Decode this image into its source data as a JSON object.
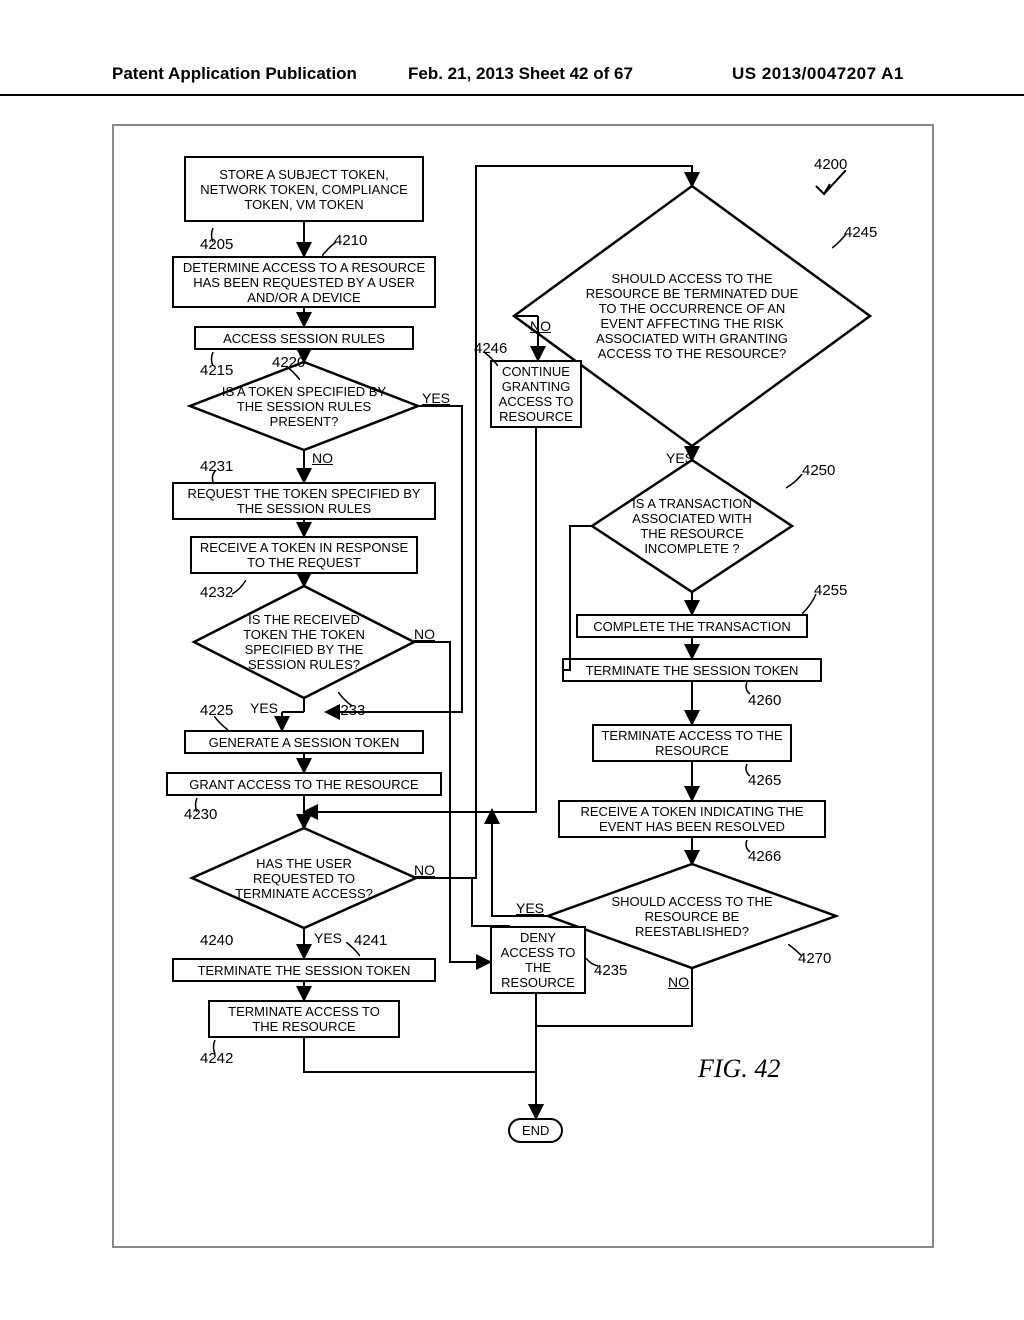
{
  "header": {
    "left": "Patent Application Publication",
    "mid": "Feb. 21, 2013  Sheet 42 of 67",
    "right": "US 2013/0047207 A1"
  },
  "refs": {
    "r4200": "4200",
    "r4205": "4205",
    "r4210": "4210",
    "r4215": "4215",
    "r4220": "4220",
    "r4225": "4225",
    "r4230": "4230",
    "r4231": "4231",
    "r4232": "4232",
    "r4233": "4233",
    "r4235": "4235",
    "r4240": "4240",
    "r4241": "4241",
    "r4242": "4242",
    "r4245": "4245",
    "r4246": "4246",
    "r4250": "4250",
    "r4255": "4255",
    "r4260": "4260",
    "r4265": "4265",
    "r4266": "4266",
    "r4270": "4270"
  },
  "labels": {
    "yes": "YES",
    "no": "NO",
    "end": "END"
  },
  "boxes": {
    "b4205": "STORE A SUBJECT TOKEN, NETWORK TOKEN, COMPLIANCE TOKEN, VM TOKEN",
    "b4210": "DETERMINE ACCESS TO A RESOURCE HAS BEEN REQUESTED BY A USER AND/OR A DEVICE",
    "b4215": "ACCESS SESSION RULES",
    "d4220": "IS A TOKEN SPECIFIED BY THE SESSION RULES PRESENT?",
    "b4231": "REQUEST THE TOKEN SPECIFIED BY THE SESSION RULES",
    "b4232": "RECEIVE A TOKEN IN RESPONSE TO THE REQUEST",
    "d4233": "IS THE RECEIVED TOKEN THE TOKEN SPECIFIED BY THE SESSION RULES?",
    "b4225": "GENERATE A SESSION TOKEN",
    "b4230": "GRANT ACCESS TO THE RESOURCE",
    "d4240": "HAS THE USER REQUESTED TO TERMINATE ACCESS?",
    "b4241": "TERMINATE THE SESSION TOKEN",
    "b4242": "TERMINATE ACCESS TO THE RESOURCE",
    "d4245": "SHOULD ACCESS TO THE RESOURCE BE TERMINATED DUE TO THE OCCURRENCE OF AN EVENT AFFECTING THE RISK ASSOCIATED WITH GRANTING ACCESS TO THE RESOURCE?",
    "b4246": "CONTINUE GRANTING ACCESS TO RESOURCE",
    "d4250": "IS A TRANSACTION ASSOCIATED WITH THE RESOURCE INCOMPLETE ?",
    "b4255": "COMPLETE THE TRANSACTION",
    "b4260": "TERMINATE THE SESSION TOKEN",
    "b4265": "TERMINATE ACCESS TO THE RESOURCE",
    "b4266": "RECEIVE A TOKEN INDICATING THE EVENT HAS BEEN RESOLVED",
    "d4270": "SHOULD ACCESS TO THE RESOURCE BE REESTABLISHED?",
    "b4235": "DENY ACCESS TO THE RESOURCE"
  },
  "figure": "FIG. 42"
}
